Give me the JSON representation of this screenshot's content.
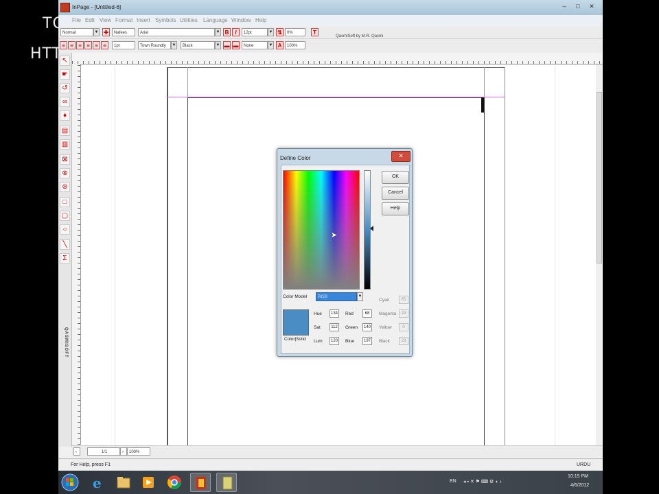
{
  "overlay": {
    "line1": "TO",
    "line2": "HTTI"
  },
  "window": {
    "title": "InPage - [Untitled-6]",
    "min": "–",
    "max": "□",
    "close": "✕"
  },
  "menu": [
    "File",
    "Edit",
    "View",
    "Format",
    "Insert",
    "Symbols",
    "Utilities",
    "Language",
    "Window",
    "Help"
  ],
  "toolbar1": {
    "style": "Normal",
    "font_value": "Nafees",
    "font2": "Arial",
    "bold": "B",
    "italic": "I",
    "size": "12pt",
    "zoom": "0%"
  },
  "toolbar2": {
    "size": "1pt",
    "mode": "Town Roundly",
    "color": "Black",
    "fill": "None",
    "pct": "100%"
  },
  "credit": "QasmiSoft by M.R. Qasmi",
  "bottombar": {
    "page": "1/1",
    "zoom": "100%"
  },
  "status": {
    "help": "For Help, press F1",
    "lang": "URDU"
  },
  "dialog": {
    "title": "Define Color",
    "close": "✕",
    "ok": "OK",
    "cancel": "Cancel",
    "help": "Help",
    "color_model_label": "Color Model",
    "color_model_value": "RGB",
    "swatch_label": "Color|Solid",
    "swatch_color": "#4a8cc4",
    "hsl": {
      "hue_label": "Hue",
      "hue": "134",
      "sat_label": "Sat",
      "sat": "112",
      "lum_label": "Lum",
      "lum": "120"
    },
    "rgb": {
      "red_label": "Red",
      "red": "68",
      "green_label": "Green",
      "green": "140",
      "blue_label": "Blue",
      "blue": "197"
    },
    "cmyk": {
      "cyan_label": "Cyan",
      "cyan": "65",
      "magenta_label": "Magenta",
      "magenta": "29",
      "yellow_label": "Yellow",
      "yellow": "0",
      "black_label": "Black",
      "black": "23"
    }
  },
  "tray": {
    "lang": "EN",
    "time": "10:15 PM",
    "date": "4/6/2012"
  },
  "vertical_label": "QASMISOFT"
}
